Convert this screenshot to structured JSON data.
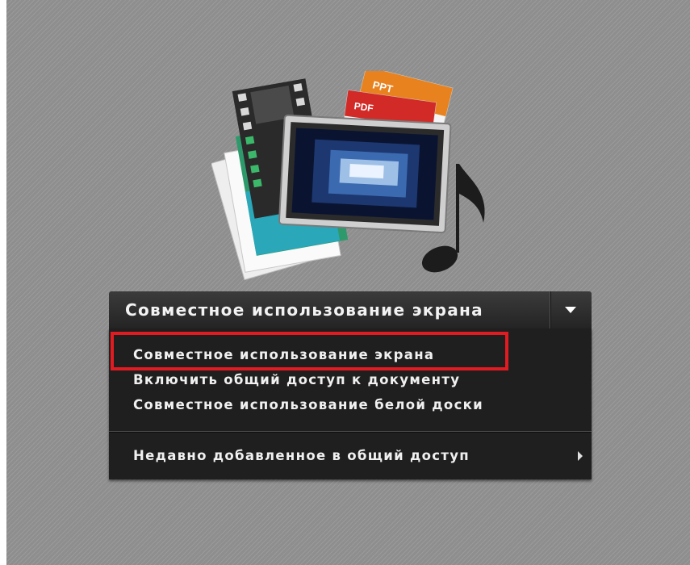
{
  "share_button": {
    "label": "Совместное использование экрана",
    "toggle_icon": "chevron-down-icon"
  },
  "menu": {
    "items": [
      {
        "label": "Совместное использование экрана",
        "highlighted": true
      },
      {
        "label": "Включить общий доступ к документу"
      },
      {
        "label": "Совместное использование белой доски"
      }
    ],
    "recent": {
      "label": "Недавно добавленное в общий доступ",
      "icon": "chevron-right-icon"
    }
  },
  "illustration": {
    "ppt_label": "PPT",
    "pdf_label": "PDF",
    "icons": [
      "film-strip-icon",
      "photo-icon",
      "screen-icon",
      "music-note-icon"
    ]
  },
  "colors": {
    "background": "#8e8e8e",
    "menu": "#1f1f1f",
    "highlight": "#e11b22",
    "ppt": "#e8821e",
    "pdf": "#d22b27"
  }
}
